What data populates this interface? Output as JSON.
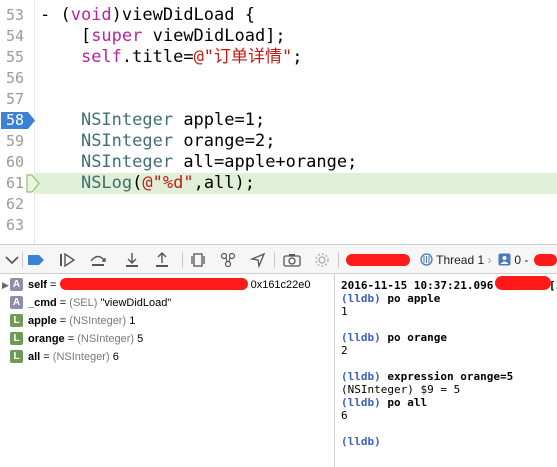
{
  "editor": {
    "lines": [
      {
        "n": "53",
        "code": [
          {
            "t": "- (",
            "c": ""
          },
          {
            "t": "void",
            "c": "kw"
          },
          {
            "t": ")viewDidLoad {",
            "c": ""
          }
        ]
      },
      {
        "n": "54",
        "code": [
          {
            "t": "    [",
            "c": ""
          },
          {
            "t": "super",
            "c": "kw"
          },
          {
            "t": " viewDidLoad];",
            "c": ""
          }
        ]
      },
      {
        "n": "55",
        "code": [
          {
            "t": "    ",
            "c": ""
          },
          {
            "t": "self",
            "c": "kw"
          },
          {
            "t": ".title=",
            "c": ""
          },
          {
            "t": "@\"订单详情\"",
            "c": "str"
          },
          {
            "t": ";",
            "c": ""
          }
        ]
      },
      {
        "n": "56",
        "code": []
      },
      {
        "n": "57",
        "code": []
      },
      {
        "n": "58",
        "code": [
          {
            "t": "    ",
            "c": ""
          },
          {
            "t": "NSInteger",
            "c": "cls"
          },
          {
            "t": " apple=1;",
            "c": ""
          }
        ]
      },
      {
        "n": "59",
        "code": [
          {
            "t": "    ",
            "c": ""
          },
          {
            "t": "NSInteger",
            "c": "cls"
          },
          {
            "t": " orange=2;",
            "c": ""
          }
        ]
      },
      {
        "n": "60",
        "code": [
          {
            "t": "    ",
            "c": ""
          },
          {
            "t": "NSInteger",
            "c": "cls"
          },
          {
            "t": " all=apple+orange;",
            "c": ""
          }
        ]
      },
      {
        "n": "61",
        "code": [
          {
            "t": "    ",
            "c": ""
          },
          {
            "t": "NSLog",
            "c": "cls"
          },
          {
            "t": "(",
            "c": ""
          },
          {
            "t": "@\"%d\"",
            "c": "str"
          },
          {
            "t": ",all);",
            "c": ""
          }
        ]
      },
      {
        "n": "62",
        "code": []
      },
      {
        "n": "63",
        "code": []
      }
    ],
    "breakpoint_line": "58",
    "current_line": "61"
  },
  "debug_bar": {
    "thread_label": "Thread 1",
    "frame_label": "0 -"
  },
  "variables": [
    {
      "expand": "▶",
      "badge": "A",
      "name": "self",
      "type": "",
      "value": "0x161c22e0",
      "redacted": true
    },
    {
      "expand": "",
      "badge": "A",
      "name": "_cmd",
      "type": "(SEL)",
      "value": "\"viewDidLoad\"",
      "redacted": false
    },
    {
      "expand": "",
      "badge": "L",
      "name": "apple",
      "type": "(NSInteger)",
      "value": "1",
      "redacted": false
    },
    {
      "expand": "",
      "badge": "L",
      "name": "orange",
      "type": "(NSInteger)",
      "value": "5",
      "redacted": false
    },
    {
      "expand": "",
      "badge": "L",
      "name": "all",
      "type": "(NSInteger)",
      "value": "6",
      "redacted": false
    }
  ],
  "console": {
    "log_line": "2016-11-15 10:37:21.096",
    "log_tail": "[1",
    "entries": [
      {
        "kind": "cmd",
        "prompt": "(lldb)",
        "text": "po apple"
      },
      {
        "kind": "out",
        "text": "1"
      },
      {
        "kind": "blank",
        "text": ""
      },
      {
        "kind": "cmd",
        "prompt": "(lldb)",
        "text": "po orange"
      },
      {
        "kind": "out",
        "text": "2"
      },
      {
        "kind": "blank",
        "text": ""
      },
      {
        "kind": "cmd",
        "prompt": "(lldb)",
        "text": "expression orange=5"
      },
      {
        "kind": "out",
        "text": "(NSInteger) $9 = 5"
      },
      {
        "kind": "cmd",
        "prompt": "(lldb)",
        "text": "po all"
      },
      {
        "kind": "out",
        "text": "6"
      },
      {
        "kind": "blank",
        "text": ""
      },
      {
        "kind": "cmd",
        "prompt": "(lldb)",
        "text": ""
      }
    ]
  },
  "colors": {
    "keyword": "#b8239e",
    "string": "#c41a16",
    "class": "#3f6e74",
    "breakpoint": "#3b82d6",
    "current_line_bg": "#dff0d6",
    "prompt": "#3b5ec7",
    "redaction": "#ff1a1a"
  },
  "icons": [
    "hide-debug-area-icon",
    "breakpoint-toggle-icon",
    "continue-icon",
    "step-over-icon",
    "step-into-icon",
    "step-out-icon",
    "view-hierarchy-icon",
    "memory-graph-icon",
    "simulate-location-icon",
    "camera-icon",
    "settings-icon",
    "thread-icon",
    "frame-icon"
  ]
}
